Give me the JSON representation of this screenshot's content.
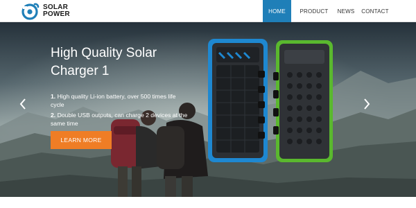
{
  "brand": {
    "line1": "SOLAR",
    "line2": "POWER",
    "logo_icon": "sun-ring-logo",
    "color": "#1f7fb8"
  },
  "nav": {
    "items": [
      {
        "label": "HOME",
        "active": true
      },
      {
        "label": "PRODUCT",
        "active": false
      },
      {
        "label": "NEWS",
        "active": false
      },
      {
        "label": "CONTACT",
        "active": false
      }
    ]
  },
  "hero": {
    "title_line1": "High Quality Solar",
    "title_line2": "Charger 1",
    "features": [
      {
        "number": "1.",
        "text": "High quality Li-ion battery, over 500 times life cycle"
      },
      {
        "number": "2.",
        "text": "Double USB outputs, can charge 2 devices at the same time"
      }
    ],
    "cta_label": "LEARN MORE",
    "cta_color": "#ef7d25",
    "prev_icon": "chevron-left-icon",
    "next_icon": "chevron-right-icon"
  }
}
